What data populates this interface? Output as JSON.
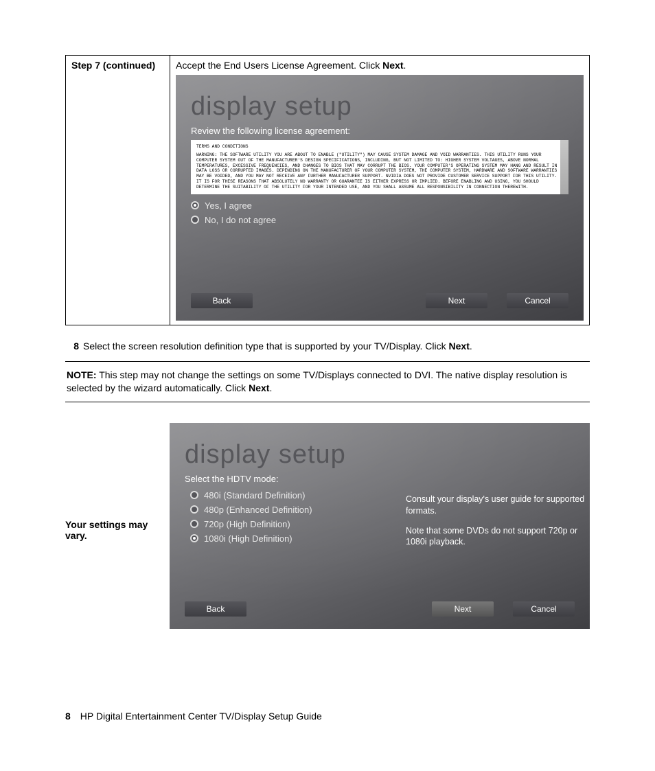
{
  "step7": {
    "label": "Step 7 (continued)",
    "instruction_pre": "Accept the End Users License Agreement. Click ",
    "instruction_bold": "Next",
    "instruction_post": "."
  },
  "shot1": {
    "title": "display setup",
    "subtitle": "Review the following license agreement:",
    "eula_head": "TERMS AND CONDITIONS",
    "eula_body": "WARNING: THE SOFTWARE UTILITY YOU ARE ABOUT TO ENABLE (\"UTILITY\") MAY CAUSE SYSTEM DAMAGE AND VOID WARRANTIES. THIS UTILITY RUNS YOUR COMPUTER SYSTEM OUT OF THE MANUFACTURER'S DESIGN SPECIFICATIONS, INCLUDING, BUT NOT LIMITED TO: HIGHER SYSTEM VOLTAGES, ABOVE NORMAL TEMPERATURES, EXCESSIVE FREQUENCIES, AND CHANGES TO BIOS THAT MAY CORRUPT THE BIOS. YOUR COMPUTER'S OPERATING SYSTEM MAY HANG AND RESULT IN DATA LOSS OR CORRUPTED IMAGES. DEPENDING ON THE MANUFACTURER OF YOUR COMPUTER SYSTEM, THE COMPUTER SYSTEM, HARDWARE AND SOFTWARE WARRANTIES MAY BE VOIDED, AND YOU MAY NOT RECEIVE ANY FURTHER MANUFACTURER SUPPORT. NVIDIA DOES NOT PROVIDE CUSTOMER SERVICE SUPPORT FOR THIS UTILITY. IT IS FOR THESE REASONS THAT ABSOLUTELY NO WARRANTY OR GUARANTEE IS EITHER EXPRESS OR IMPLIED. BEFORE ENABLING AND USING, YOU SHOULD DETERMINE THE SUITABILITY OF THE UTILITY FOR YOUR INTENDED USE, AND YOU SHALL ASSUME ALL RESPONSIBILITY IN CONNECTION THEREWITH.",
    "opt_yes": "Yes, I agree",
    "opt_no": "No, I do not agree",
    "back": "Back",
    "next": "Next",
    "cancel": "Cancel"
  },
  "step8": {
    "num": "8",
    "text_pre": "Select the screen resolution definition type that is supported by your TV/Display. Click ",
    "text_bold": "Next",
    "text_post": "."
  },
  "note": {
    "label": "NOTE:",
    "body_pre": " This step may not change the settings on some TV/Displays connected to DVI. The native display resolution is selected by the wizard automatically. Click ",
    "body_bold": "Next",
    "body_post": "."
  },
  "fig2_label": "Your settings may vary.",
  "shot2": {
    "title": "display setup",
    "subtitle": "Select the HDTV mode:",
    "opts": [
      "480i (Standard Definition)",
      "480p (Enhanced Definition)",
      "720p (High Definition)",
      "1080i (High Definition)"
    ],
    "side1": "Consult your display's user guide for supported formats.",
    "side2": "Note that some DVDs do not support 720p or 1080i playback.",
    "back": "Back",
    "next": "Next",
    "cancel": "Cancel"
  },
  "footer": {
    "page": "8",
    "title": "HP Digital Entertainment Center TV/Display Setup Guide"
  }
}
